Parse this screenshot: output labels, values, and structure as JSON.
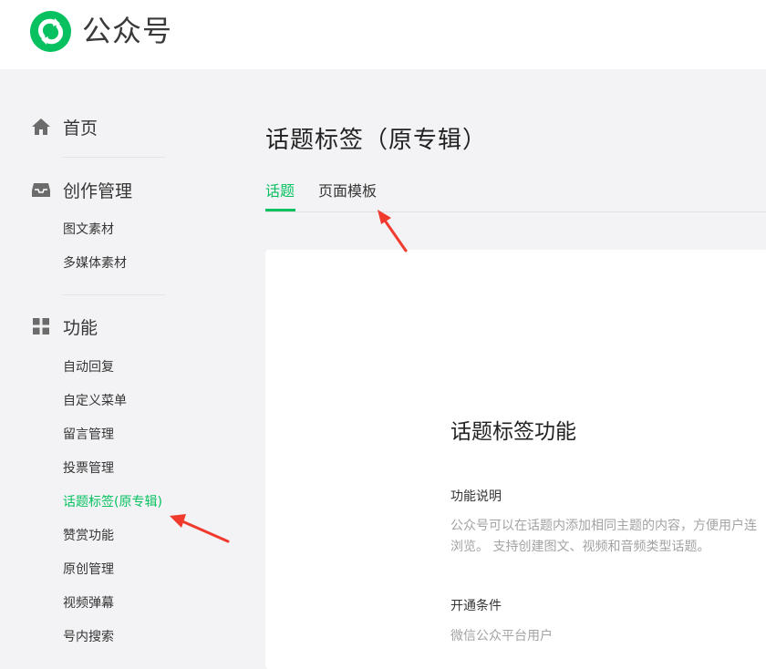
{
  "brand": {
    "name": "公众号",
    "accent": "#07c160"
  },
  "sidebar": {
    "sections": [
      {
        "label": "首页",
        "icon": "home-icon",
        "items": []
      },
      {
        "label": "创作管理",
        "icon": "inbox-icon",
        "items": [
          "图文素材",
          "多媒体素材"
        ]
      },
      {
        "label": "功能",
        "icon": "grid-icon",
        "items": [
          "自动回复",
          "自定义菜单",
          "留言管理",
          "投票管理",
          "话题标签(原专辑)",
          "赞赏功能",
          "原创管理",
          "视频弹幕",
          "号内搜索"
        ]
      }
    ],
    "active_item": "话题标签(原专辑)"
  },
  "main": {
    "title": "话题标签（原专辑）",
    "tabs": [
      {
        "label": "话题",
        "active": true
      },
      {
        "label": "页面模板",
        "active": false
      }
    ],
    "card": {
      "heading": "话题标签功能",
      "desc_label": "功能说明",
      "desc_line1": "公众号可以在话题内添加相同主题的内容，方便用户连",
      "desc_line2": "浏览。 支持创建图文、视频和音频类型话题。",
      "cond_label": "开通条件",
      "cond_text": "微信公众平台用户"
    }
  },
  "annotations": {
    "arrow_color": "#f03a2e"
  }
}
